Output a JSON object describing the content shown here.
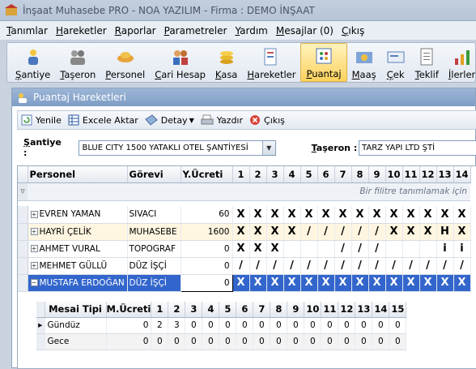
{
  "app": {
    "title": "İnşaat Muhasebe PRO - NOA YAZILIM - Firma : DEMO İNŞAAT"
  },
  "menu": [
    "Tanımlar",
    "Hareketler",
    "Raporlar",
    "Parametreler",
    "Yardım",
    "Mesajlar (0)",
    "Çıkış"
  ],
  "toolbar": [
    "Şantiye",
    "Taşeron",
    "Personel",
    "Cari Hesap",
    "Kasa",
    "Hareketler",
    "Puantaj",
    "Maaş",
    "Çek",
    "Teklif",
    "İlerler"
  ],
  "window": {
    "title": "Puantaj Hareketleri"
  },
  "window_toolbar": {
    "refresh": "Yenile",
    "excel": "Excele Aktar",
    "detail": "Detay",
    "print": "Yazdır",
    "exit": "Çıkış"
  },
  "filters": {
    "santiye_label": "Şantiye :",
    "santiye_value": "BLUE CITY 1500 YATAKLI OTEL ŞANTİYESİ",
    "taseron_label": "Taşeron :",
    "taseron_value": "TARZ YAPI LTD ŞTİ"
  },
  "grid": {
    "headers": {
      "personel": "Personel",
      "gorevi": "Görevi",
      "ucret": "Y.Ücreti",
      "days": [
        "1",
        "2",
        "3",
        "4",
        "5",
        "6",
        "7",
        "8",
        "9",
        "10",
        "11",
        "12",
        "13",
        "14"
      ]
    },
    "filter_text": "Bir filitre tanımlamak için",
    "rows": [
      {
        "name": "EVREN YAMAN",
        "job": "SIVACI",
        "wage": "60",
        "marks": [
          "X",
          "X",
          "X",
          "X",
          "X",
          "X",
          "X",
          "X",
          "X",
          "X",
          "X",
          "X",
          "X",
          "X"
        ]
      },
      {
        "name": "HAYRİ ÇELİK",
        "job": "MUHASEBE",
        "wage": "1600",
        "marks": [
          "X",
          "X",
          "X",
          "X",
          "/",
          "/",
          "/",
          "/",
          "/",
          "X",
          "X",
          "X",
          "H",
          "X"
        ]
      },
      {
        "name": "AHMET VURAL",
        "job": "TOPOGRAF",
        "wage": "0",
        "marks": [
          "X",
          "X",
          "X",
          "",
          "",
          "",
          "/",
          "/",
          "/",
          "",
          "",
          "",
          "i",
          "i"
        ]
      },
      {
        "name": "MEHMET GÜLLÜ",
        "job": "DÜZ İŞÇİ",
        "wage": "0",
        "marks": [
          "/",
          "/",
          "/",
          "/",
          "/",
          "/",
          "/",
          "/",
          "/",
          "/",
          "/",
          "/",
          "/",
          "/"
        ]
      },
      {
        "name": "MUSTAFA ERDOĞAN",
        "job": "DÜZ İŞÇİ",
        "wage": "0",
        "marks": [
          "X",
          "X",
          "X",
          "X",
          "X",
          "X",
          "X",
          "X",
          "X",
          "X",
          "X",
          "X",
          "X",
          "X"
        ]
      }
    ]
  },
  "detail": {
    "headers": {
      "tip": "Mesai Tipi",
      "ucret": "M.Ücreti",
      "days": [
        "1",
        "2",
        "3",
        "4",
        "5",
        "6",
        "7",
        "8",
        "9",
        "10",
        "11",
        "12",
        "13",
        "14",
        "15"
      ]
    },
    "rows": [
      {
        "tip": "Gündüz",
        "ucret": "0",
        "vals": [
          "2",
          "3",
          "0",
          "0",
          "0",
          "0",
          "0",
          "0",
          "0",
          "0",
          "0",
          "0",
          "0",
          "0",
          "0"
        ]
      },
      {
        "tip": "Gece",
        "ucret": "0",
        "vals": [
          "0",
          "0",
          "0",
          "0",
          "0",
          "0",
          "0",
          "0",
          "0",
          "0",
          "0",
          "0",
          "0",
          "0",
          "0"
        ]
      }
    ]
  },
  "colors": {
    "accent": "#3366cc",
    "active_tab": "#fcd25e",
    "title_bar": "#7e9dc6"
  }
}
